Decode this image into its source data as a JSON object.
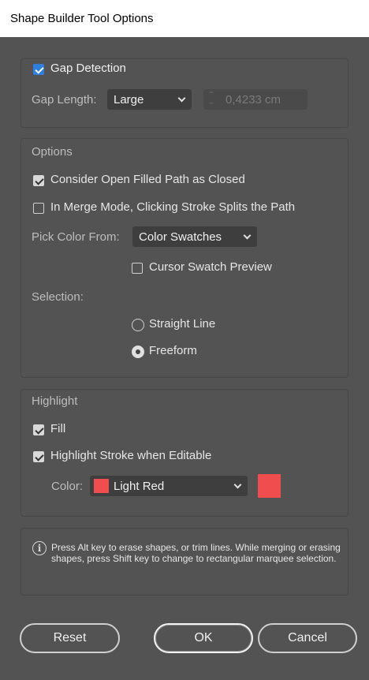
{
  "window": {
    "title": "Shape Builder Tool Options"
  },
  "gap": {
    "detection_label": "Gap Detection",
    "detection_checked": true,
    "length_label": "Gap Length:",
    "length_value": "Large",
    "length_amount": "0,4233 cm"
  },
  "options": {
    "header": "Options",
    "open_filled_label": "Consider Open Filled Path as Closed",
    "merge_mode_label": "In Merge Mode, Clicking Stroke Splits the Path",
    "pick_color_label": "Pick Color From:",
    "pick_color_value": "Color Swatches",
    "cursor_preview_label": "Cursor Swatch Preview",
    "selection_label": "Selection:",
    "radio_straight": "Straight Line",
    "radio_freeform": "Freeform",
    "selected": "Freeform"
  },
  "highlight": {
    "header": "Highlight",
    "fill_label": "Fill",
    "stroke_label": "Highlight Stroke when Editable",
    "color_label": "Color:",
    "color_value": "Light Red",
    "color_hex": "#f04e4e"
  },
  "info": {
    "text": "Press Alt key to erase shapes, or trim lines. While merging or erasing shapes, press Shift key to change to rectangular marquee selection."
  },
  "buttons": {
    "reset": "Reset",
    "ok": "OK",
    "cancel": "Cancel"
  },
  "colors": {
    "dialog_bg": "#535353",
    "accent_blue": "#2f7fe0"
  }
}
